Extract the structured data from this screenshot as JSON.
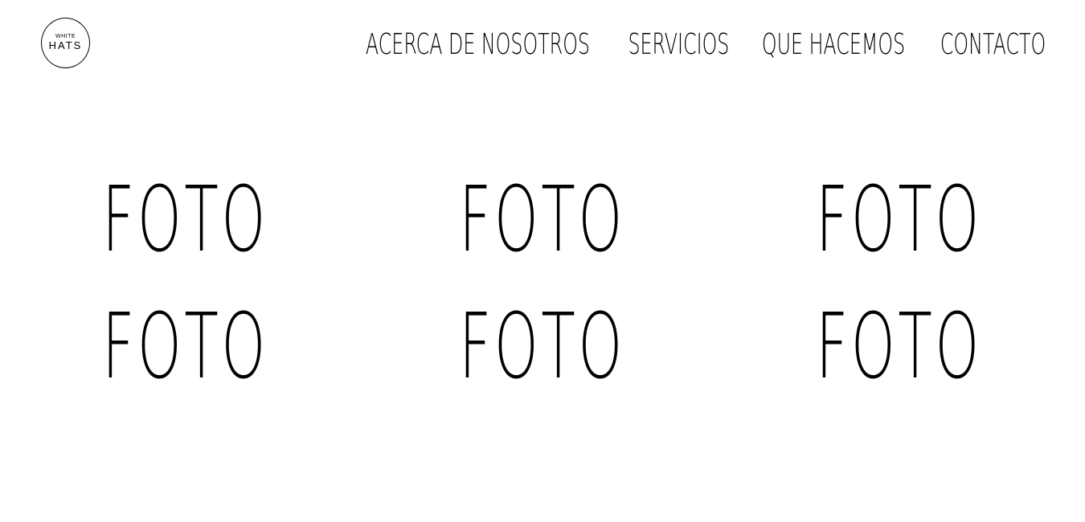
{
  "logo": {
    "top_text": "WHITE",
    "main_text": "HATS"
  },
  "nav": {
    "items": [
      {
        "label": "ACERCA DE NOSOTROS"
      },
      {
        "label": "SERVICIOS"
      },
      {
        "label": "QUE HACEMOS"
      },
      {
        "label": "CONTACTO"
      }
    ]
  },
  "gallery": {
    "photos": [
      {
        "label": "FOTO"
      },
      {
        "label": "FOTO"
      },
      {
        "label": "FOTO"
      },
      {
        "label": "FOTO"
      },
      {
        "label": "FOTO"
      },
      {
        "label": "FOTO"
      }
    ]
  }
}
